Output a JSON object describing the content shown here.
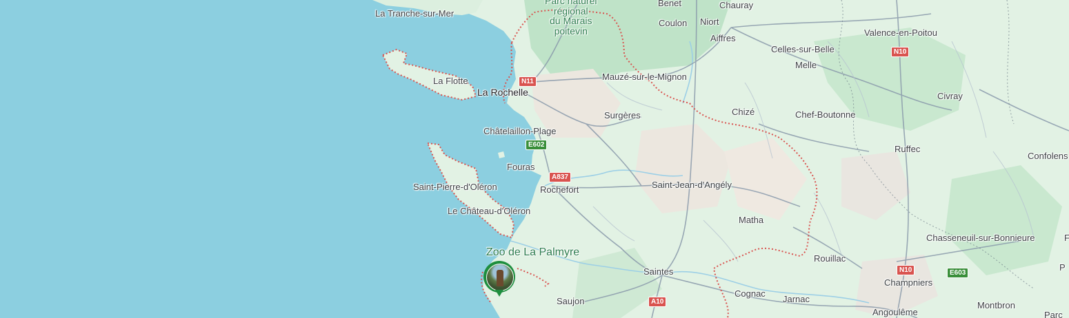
{
  "map": {
    "colors": {
      "sea": "#8ccfe0",
      "land": "#e2f2e4",
      "forest": "#bfe3c8",
      "urban": "#ece7df",
      "boundary": "#d9534f",
      "road": "#8a9aab",
      "poi_green": "#1e8e3e"
    },
    "places": {
      "la_tranche": "La Tranche-sur-Mer",
      "benet": "Benet",
      "chauray": "Chauray",
      "park_line1": "Parc naturel",
      "park_line2": "régional",
      "park_line3": "du Marais",
      "park_line4": "poitevin",
      "coulon": "Coulon",
      "niort": "Niort",
      "aiffres": "Aiffres",
      "valence": "Valence-en-Poitou",
      "celles": "Celles-sur-Belle",
      "melle": "Melle",
      "mauze": "Mauzé-sur-le-Mignon",
      "la_flotte": "La Flotte",
      "la_rochelle": "La Rochelle",
      "civray": "Civray",
      "chize": "Chizé",
      "chef_boutonne": "Chef-Boutonne",
      "surgeres": "Surgères",
      "chatelaillon": "Châtelaillon-Plage",
      "ruffec": "Ruffec",
      "confolens": "Confolens",
      "fouras": "Fouras",
      "saint_pierre": "Saint-Pierre-d'Oléron",
      "rochefort": "Rochefort",
      "saint_jean": "Saint-Jean-d'Angély",
      "chateau_oleron": "Le Château-d'Oléron",
      "matha": "Matha",
      "chasseneuil": "Chasseneuil-sur-Bonnieure",
      "zoo": "Zoo de La Palmyre",
      "rouillac": "Rouillac",
      "saintes": "Saintes",
      "champniers": "Champniers",
      "cognac": "Cognac",
      "jarnac": "Jarnac",
      "saujon": "Saujon",
      "montbron": "Montbron",
      "angouleme": "Angoulême",
      "edge_f": "F",
      "edge_p": "P",
      "edge_parc": "Parc"
    },
    "roads": {
      "n11": "N11",
      "n10_top": "N10",
      "e602": "E602",
      "a837": "A837",
      "n10_bottom": "N10",
      "e603": "E603",
      "a10": "A10"
    },
    "pin": {
      "name": "zoo-de-la-palmyre-pin",
      "icon": "photo-thumbnail"
    }
  }
}
